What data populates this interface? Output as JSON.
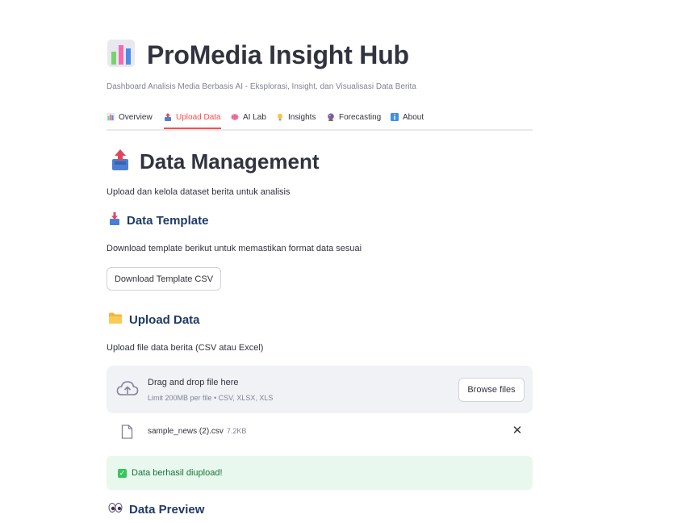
{
  "app": {
    "title": "ProMedia Insight Hub",
    "subtitle": "Dashboard Analisis Media Berbasis AI - Eksplorasi, Insight, dan Visualisasi Data Berita",
    "title_icon": "bar-chart-icon"
  },
  "tabs": [
    {
      "label": "Overview",
      "icon": "bar-chart-icon",
      "active": false
    },
    {
      "label": "Upload Data",
      "icon": "upload-tray-icon",
      "active": true
    },
    {
      "label": "AI Lab",
      "icon": "brain-icon",
      "active": false
    },
    {
      "label": "Insights",
      "icon": "lightbulb-icon",
      "active": false
    },
    {
      "label": "Forecasting",
      "icon": "crystal-ball-icon",
      "active": false
    },
    {
      "label": "About",
      "icon": "info-icon",
      "active": false
    }
  ],
  "page": {
    "title": "Data Management",
    "title_icon": "upload-tray-icon",
    "description": "Upload dan kelola dataset berita untuk analisis"
  },
  "template_section": {
    "heading": "Data Template",
    "heading_icon": "download-tray-icon",
    "description": "Download template berikut untuk memastikan format data sesuai",
    "button_label": "Download Template CSV"
  },
  "upload_section": {
    "heading": "Upload Data",
    "heading_icon": "folder-icon",
    "description": "Upload file data berita (CSV atau Excel)",
    "dropzone_title": "Drag and drop file here",
    "dropzone_limit": "Limit 200MB per file • CSV, XLSX, XLS",
    "browse_label": "Browse files"
  },
  "uploaded_file": {
    "name": "sample_news (2).csv",
    "size": "7.2KB",
    "remove_symbol": "✕"
  },
  "success": {
    "message": "Data berhasil diupload!",
    "check_symbol": "✓"
  },
  "preview_section": {
    "heading": "Data Preview",
    "heading_icon": "eyes-icon"
  },
  "colors": {
    "accent": "#ff4b4b",
    "heading_blue": "#1f3a68",
    "success_bg": "#e8f8ee",
    "success_text": "#177233"
  }
}
